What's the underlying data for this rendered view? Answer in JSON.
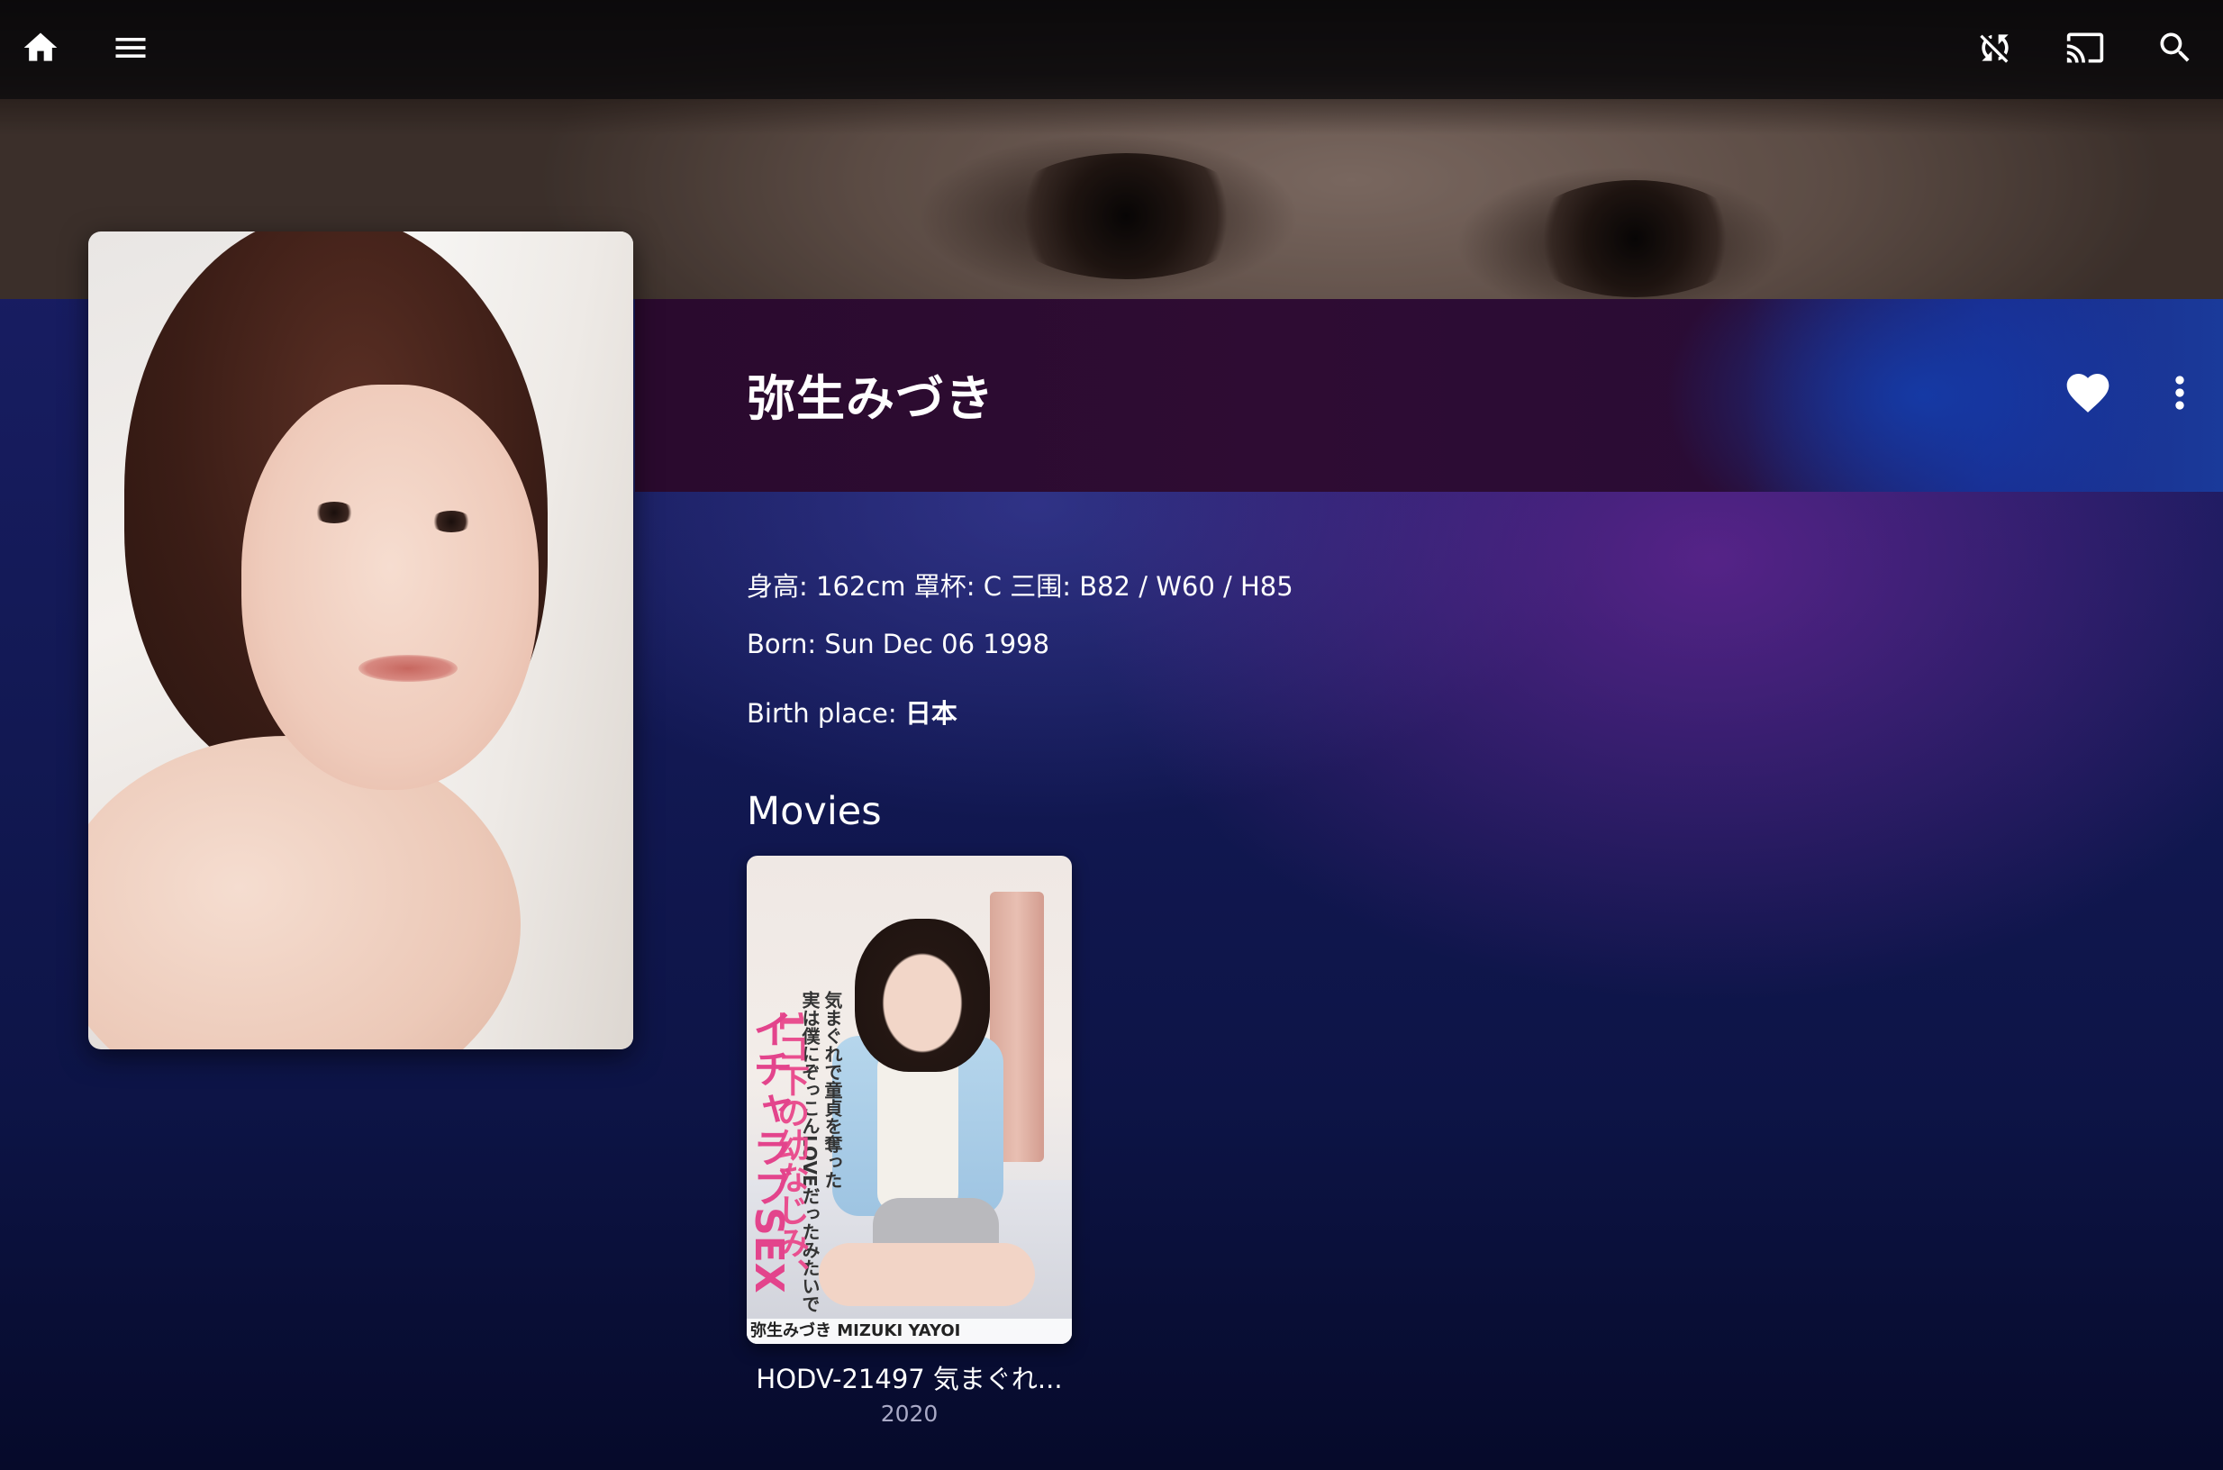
{
  "appbar": {
    "home_icon": "home-icon",
    "menu_icon": "menu-icon",
    "sync_disabled_icon": "sync-disabled-icon",
    "cast_icon": "cast-icon",
    "search_icon": "search-icon"
  },
  "person": {
    "name": "弥生みづき",
    "favorite_icon": "heart-icon",
    "more_icon": "more-vert-icon",
    "measurements": "身高: 162cm 罩杯: C 三围: B82 / W60 / H85",
    "born_label": "Born: ",
    "born_value": "Sun Dec 06 1998",
    "birthplace_label": "Birth place: ",
    "birthplace_value": "日本"
  },
  "movies": {
    "section_title": "Movies",
    "items": [
      {
        "title": "HODV-21497 気まぐれ...",
        "year": "2020",
        "poster_text": {
          "line1": "気まぐれで童貞を奪った",
          "line2": "1コ下の幼なじみ、",
          "line3": "イチャラブSEX",
          "line4": "実は僕にぞっこんLOVEだったみたいで",
          "actress": "弥生みづき MIZUKI YAYOI"
        }
      }
    ]
  },
  "colors": {
    "background_top": "#1b1f6a",
    "background_bottom": "#060a2a",
    "title_band": "#2a0c33",
    "accent_purple": "#7828a0",
    "year_text": "#a9aac6"
  }
}
